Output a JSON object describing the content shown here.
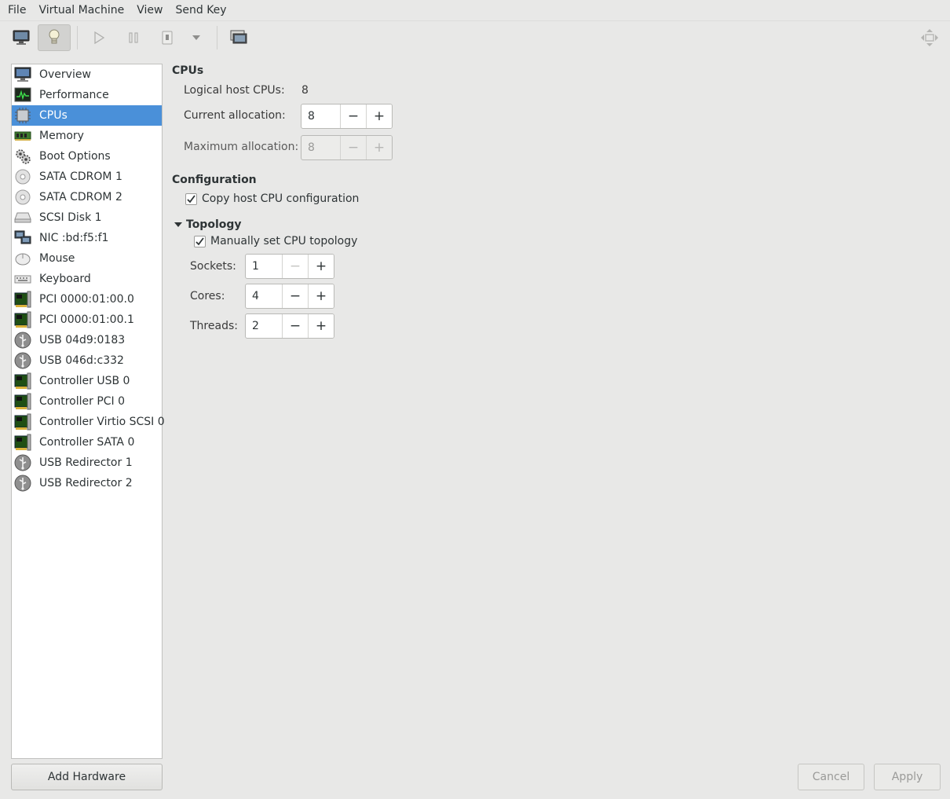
{
  "menubar": {
    "file": "File",
    "virtual_machine": "Virtual Machine",
    "view": "View",
    "send_key": "Send Key"
  },
  "toolbar": {
    "console_icon": "monitor-icon",
    "details_icon": "lightbulb-icon",
    "run_icon": "play-icon",
    "pause_icon": "pause-icon",
    "shutdown_icon": "power-icon",
    "shutdown_menu_icon": "chevron-down-icon",
    "snapshot_icon": "snapshots-icon",
    "fullscreen_icon": "fullscreen-icon"
  },
  "sidebar": {
    "items": [
      {
        "label": "Overview",
        "icon": "monitor-icon"
      },
      {
        "label": "Performance",
        "icon": "performance-icon"
      },
      {
        "label": "CPUs",
        "icon": "cpu-icon",
        "selected": true
      },
      {
        "label": "Memory",
        "icon": "memory-icon"
      },
      {
        "label": "Boot Options",
        "icon": "gears-icon"
      },
      {
        "label": "SATA CDROM 1",
        "icon": "cdrom-icon"
      },
      {
        "label": "SATA CDROM 2",
        "icon": "cdrom-icon"
      },
      {
        "label": "SCSI Disk 1",
        "icon": "disk-icon"
      },
      {
        "label": "NIC :bd:f5:f1",
        "icon": "network-icon"
      },
      {
        "label": "Mouse",
        "icon": "mouse-icon"
      },
      {
        "label": "Keyboard",
        "icon": "keyboard-icon"
      },
      {
        "label": "PCI 0000:01:00.0",
        "icon": "pci-card-icon"
      },
      {
        "label": "PCI 0000:01:00.1",
        "icon": "pci-card-icon"
      },
      {
        "label": "USB 04d9:0183",
        "icon": "usb-icon"
      },
      {
        "label": "USB 046d:c332",
        "icon": "usb-icon"
      },
      {
        "label": "Controller USB 0",
        "icon": "pci-card-icon"
      },
      {
        "label": "Controller PCI 0",
        "icon": "pci-card-icon"
      },
      {
        "label": "Controller Virtio SCSI 0",
        "icon": "pci-card-icon"
      },
      {
        "label": "Controller SATA 0",
        "icon": "pci-card-icon"
      },
      {
        "label": "USB Redirector 1",
        "icon": "usb-icon"
      },
      {
        "label": "USB Redirector 2",
        "icon": "usb-icon"
      }
    ],
    "add_hardware": "Add Hardware"
  },
  "cpus": {
    "title": "CPUs",
    "logical_host_label": "Logical host CPUs:",
    "logical_host_value": "8",
    "current_label": "Current allocation:",
    "current_value": "8",
    "maximum_label": "Maximum allocation:",
    "maximum_value": "8"
  },
  "configuration": {
    "title": "Configuration",
    "copy_host_label": "Copy host CPU configuration",
    "copy_host_checked": true
  },
  "topology": {
    "title": "Topology",
    "manual_label": "Manually set CPU topology",
    "manual_checked": true,
    "sockets_label": "Sockets:",
    "sockets_value": "1",
    "cores_label": "Cores:",
    "cores_value": "4",
    "threads_label": "Threads:",
    "threads_value": "2"
  },
  "spin": {
    "minus": "−",
    "plus": "+"
  },
  "footer": {
    "cancel": "Cancel",
    "apply": "Apply"
  }
}
